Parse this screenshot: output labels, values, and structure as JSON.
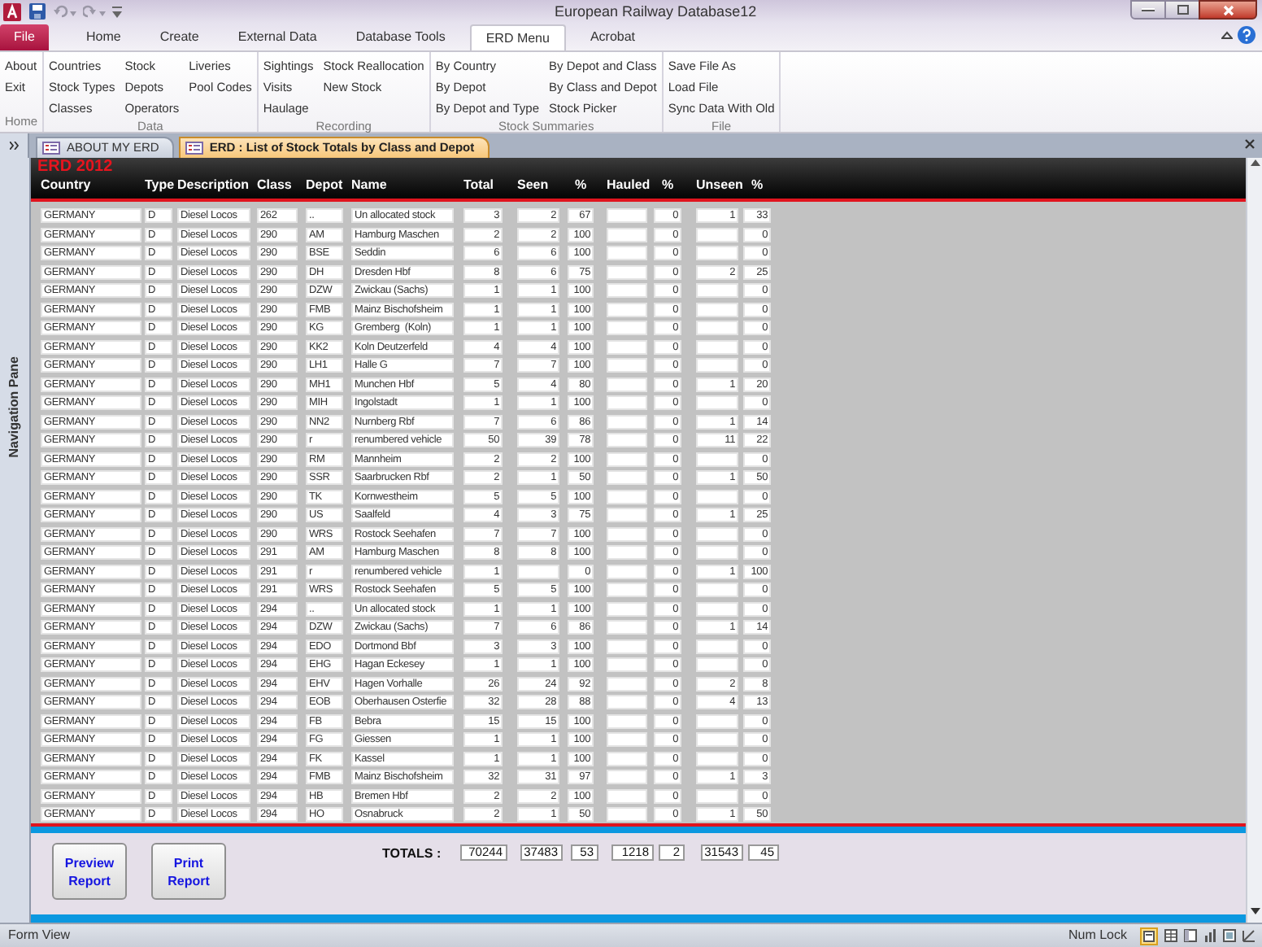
{
  "window": {
    "title": "European Railway Database12"
  },
  "ribbon": {
    "tabs": [
      {
        "label": "File",
        "kind": "file",
        "selected": false
      },
      {
        "label": "Home",
        "kind": "tab",
        "selected": false
      },
      {
        "label": "Create",
        "kind": "tab",
        "selected": false
      },
      {
        "label": "External Data",
        "kind": "tab",
        "selected": false
      },
      {
        "label": "Database Tools",
        "kind": "tab",
        "selected": false
      },
      {
        "label": "ERD Menu",
        "kind": "tab",
        "selected": true
      },
      {
        "label": "Acrobat",
        "kind": "tab",
        "selected": false
      }
    ],
    "groups": [
      {
        "label": "Home",
        "columns": [
          [
            "About",
            "Exit"
          ]
        ]
      },
      {
        "label": "Data",
        "columns": [
          [
            "Countries",
            "Stock Types",
            "Classes"
          ],
          [
            "Stock",
            "Depots",
            "Operators"
          ],
          [
            "Liveries",
            "Pool Codes"
          ]
        ]
      },
      {
        "label": "Recording",
        "columns": [
          [
            "Sightings",
            "Visits",
            "Haulage"
          ],
          [
            "Stock Reallocation",
            "New Stock"
          ]
        ]
      },
      {
        "label": "Stock Summaries",
        "columns": [
          [
            "By Country",
            "By Depot",
            "By Depot and Type"
          ],
          [
            "By Depot and Class",
            "By Class and Depot",
            "Stock Picker"
          ]
        ]
      },
      {
        "label": "File",
        "columns": [
          [
            "Save File As",
            "Load File",
            "Sync Data With Old"
          ]
        ]
      }
    ]
  },
  "document_tabs": [
    {
      "label": "ABOUT MY ERD",
      "selected": false
    },
    {
      "label": "ERD : List of Stock Totals by Class and Depot",
      "selected": true
    }
  ],
  "navigation_pane": {
    "label": "Navigation Pane"
  },
  "form": {
    "title": "ERD 2012",
    "columns": [
      "Country",
      "Type",
      "Description",
      "Class",
      "Depot",
      "Name",
      "Total",
      "Seen",
      "%",
      "Hauled",
      "%",
      "Unseen",
      "%"
    ],
    "rows": [
      {
        "country": "GERMANY",
        "type": "D",
        "description": "Diesel Locos",
        "class": "262",
        "depot": "..",
        "name": "Un allocated stock",
        "total": "3",
        "seen": "2",
        "seen_pct": "67",
        "hauled_pct": "0",
        "unseen": "1",
        "unseen_pct": "33"
      },
      {
        "country": "GERMANY",
        "type": "D",
        "description": "Diesel Locos",
        "class": "290",
        "depot": "AM",
        "name": "Hamburg Maschen",
        "total": "2",
        "seen": "2",
        "seen_pct": "100",
        "hauled_pct": "0",
        "unseen_pct": "0"
      },
      {
        "country": "GERMANY",
        "type": "D",
        "description": "Diesel Locos",
        "class": "290",
        "depot": "BSE",
        "name": "Seddin",
        "total": "6",
        "seen": "6",
        "seen_pct": "100",
        "hauled_pct": "0",
        "unseen_pct": "0"
      },
      {
        "country": "GERMANY",
        "type": "D",
        "description": "Diesel Locos",
        "class": "290",
        "depot": "DH",
        "name": "Dresden Hbf",
        "total": "8",
        "seen": "6",
        "seen_pct": "75",
        "hauled_pct": "0",
        "unseen": "2",
        "unseen_pct": "25"
      },
      {
        "country": "GERMANY",
        "type": "D",
        "description": "Diesel Locos",
        "class": "290",
        "depot": "DZW",
        "name": "Zwickau (Sachs)",
        "total": "1",
        "seen": "1",
        "seen_pct": "100",
        "hauled_pct": "0",
        "unseen_pct": "0"
      },
      {
        "country": "GERMANY",
        "type": "D",
        "description": "Diesel Locos",
        "class": "290",
        "depot": "FMB",
        "name": "Mainz Bischofsheim",
        "total": "1",
        "seen": "1",
        "seen_pct": "100",
        "hauled_pct": "0",
        "unseen_pct": "0"
      },
      {
        "country": "GERMANY",
        "type": "D",
        "description": "Diesel Locos",
        "class": "290",
        "depot": "KG",
        "name": "Gremberg  (Koln)",
        "total": "1",
        "seen": "1",
        "seen_pct": "100",
        "hauled_pct": "0",
        "unseen_pct": "0"
      },
      {
        "country": "GERMANY",
        "type": "D",
        "description": "Diesel Locos",
        "class": "290",
        "depot": "KK2",
        "name": "Koln Deutzerfeld",
        "total": "4",
        "seen": "4",
        "seen_pct": "100",
        "hauled_pct": "0",
        "unseen_pct": "0"
      },
      {
        "country": "GERMANY",
        "type": "D",
        "description": "Diesel Locos",
        "class": "290",
        "depot": "LH1",
        "name": "Halle G",
        "total": "7",
        "seen": "7",
        "seen_pct": "100",
        "hauled_pct": "0",
        "unseen_pct": "0"
      },
      {
        "country": "GERMANY",
        "type": "D",
        "description": "Diesel Locos",
        "class": "290",
        "depot": "MH1",
        "name": "Munchen Hbf",
        "total": "5",
        "seen": "4",
        "seen_pct": "80",
        "hauled_pct": "0",
        "unseen": "1",
        "unseen_pct": "20"
      },
      {
        "country": "GERMANY",
        "type": "D",
        "description": "Diesel Locos",
        "class": "290",
        "depot": "MIH",
        "name": "Ingolstadt",
        "total": "1",
        "seen": "1",
        "seen_pct": "100",
        "hauled_pct": "0",
        "unseen_pct": "0"
      },
      {
        "country": "GERMANY",
        "type": "D",
        "description": "Diesel Locos",
        "class": "290",
        "depot": "NN2",
        "name": "Nurnberg Rbf",
        "total": "7",
        "seen": "6",
        "seen_pct": "86",
        "hauled_pct": "0",
        "unseen": "1",
        "unseen_pct": "14"
      },
      {
        "country": "GERMANY",
        "type": "D",
        "description": "Diesel Locos",
        "class": "290",
        "depot": "r",
        "name": "renumbered vehicle",
        "total": "50",
        "seen": "39",
        "seen_pct": "78",
        "hauled_pct": "0",
        "unseen": "11",
        "unseen_pct": "22"
      },
      {
        "country": "GERMANY",
        "type": "D",
        "description": "Diesel Locos",
        "class": "290",
        "depot": "RM",
        "name": "Mannheim",
        "total": "2",
        "seen": "2",
        "seen_pct": "100",
        "hauled_pct": "0",
        "unseen_pct": "0"
      },
      {
        "country": "GERMANY",
        "type": "D",
        "description": "Diesel Locos",
        "class": "290",
        "depot": "SSR",
        "name": "Saarbrucken Rbf",
        "total": "2",
        "seen": "1",
        "seen_pct": "50",
        "hauled_pct": "0",
        "unseen": "1",
        "unseen_pct": "50"
      },
      {
        "country": "GERMANY",
        "type": "D",
        "description": "Diesel Locos",
        "class": "290",
        "depot": "TK",
        "name": "Kornwestheim",
        "total": "5",
        "seen": "5",
        "seen_pct": "100",
        "hauled_pct": "0",
        "unseen_pct": "0"
      },
      {
        "country": "GERMANY",
        "type": "D",
        "description": "Diesel Locos",
        "class": "290",
        "depot": "US",
        "name": "Saalfeld",
        "total": "4",
        "seen": "3",
        "seen_pct": "75",
        "hauled_pct": "0",
        "unseen": "1",
        "unseen_pct": "25"
      },
      {
        "country": "GERMANY",
        "type": "D",
        "description": "Diesel Locos",
        "class": "290",
        "depot": "WRS",
        "name": "Rostock Seehafen",
        "total": "7",
        "seen": "7",
        "seen_pct": "100",
        "hauled_pct": "0",
        "unseen_pct": "0"
      },
      {
        "country": "GERMANY",
        "type": "D",
        "description": "Diesel Locos",
        "class": "291",
        "depot": "AM",
        "name": "Hamburg Maschen",
        "total": "8",
        "seen": "8",
        "seen_pct": "100",
        "hauled_pct": "0",
        "unseen_pct": "0"
      },
      {
        "country": "GERMANY",
        "type": "D",
        "description": "Diesel Locos",
        "class": "291",
        "depot": "r",
        "name": "renumbered vehicle",
        "total": "1",
        "seen_pct": "0",
        "hauled_pct": "0",
        "unseen": "1",
        "unseen_pct": "100"
      },
      {
        "country": "GERMANY",
        "type": "D",
        "description": "Diesel Locos",
        "class": "291",
        "depot": "WRS",
        "name": "Rostock Seehafen",
        "total": "5",
        "seen": "5",
        "seen_pct": "100",
        "hauled_pct": "0",
        "unseen_pct": "0"
      },
      {
        "country": "GERMANY",
        "type": "D",
        "description": "Diesel Locos",
        "class": "294",
        "depot": "..",
        "name": "Un allocated stock",
        "total": "1",
        "seen": "1",
        "seen_pct": "100",
        "hauled_pct": "0",
        "unseen_pct": "0"
      },
      {
        "country": "GERMANY",
        "type": "D",
        "description": "Diesel Locos",
        "class": "294",
        "depot": "DZW",
        "name": "Zwickau (Sachs)",
        "total": "7",
        "seen": "6",
        "seen_pct": "86",
        "hauled_pct": "0",
        "unseen": "1",
        "unseen_pct": "14"
      },
      {
        "country": "GERMANY",
        "type": "D",
        "description": "Diesel Locos",
        "class": "294",
        "depot": "EDO",
        "name": "Dortmond Bbf",
        "total": "3",
        "seen": "3",
        "seen_pct": "100",
        "hauled_pct": "0",
        "unseen_pct": "0"
      },
      {
        "country": "GERMANY",
        "type": "D",
        "description": "Diesel Locos",
        "class": "294",
        "depot": "EHG",
        "name": "Hagan Eckesey",
        "total": "1",
        "seen": "1",
        "seen_pct": "100",
        "hauled_pct": "0",
        "unseen_pct": "0"
      },
      {
        "country": "GERMANY",
        "type": "D",
        "description": "Diesel Locos",
        "class": "294",
        "depot": "EHV",
        "name": "Hagen Vorhalle",
        "total": "26",
        "seen": "24",
        "seen_pct": "92",
        "hauled_pct": "0",
        "unseen": "2",
        "unseen_pct": "8"
      },
      {
        "country": "GERMANY",
        "type": "D",
        "description": "Diesel Locos",
        "class": "294",
        "depot": "EOB",
        "name": "Oberhausen Osterfie",
        "total": "32",
        "seen": "28",
        "seen_pct": "88",
        "hauled_pct": "0",
        "unseen": "4",
        "unseen_pct": "13"
      },
      {
        "country": "GERMANY",
        "type": "D",
        "description": "Diesel Locos",
        "class": "294",
        "depot": "FB",
        "name": "Bebra",
        "total": "15",
        "seen": "15",
        "seen_pct": "100",
        "hauled_pct": "0",
        "unseen_pct": "0"
      },
      {
        "country": "GERMANY",
        "type": "D",
        "description": "Diesel Locos",
        "class": "294",
        "depot": "FG",
        "name": "Giessen",
        "total": "1",
        "seen": "1",
        "seen_pct": "100",
        "hauled_pct": "0",
        "unseen_pct": "0"
      },
      {
        "country": "GERMANY",
        "type": "D",
        "description": "Diesel Locos",
        "class": "294",
        "depot": "FK",
        "name": "Kassel",
        "total": "1",
        "seen": "1",
        "seen_pct": "100",
        "hauled_pct": "0",
        "unseen_pct": "0"
      },
      {
        "country": "GERMANY",
        "type": "D",
        "description": "Diesel Locos",
        "class": "294",
        "depot": "FMB",
        "name": "Mainz Bischofsheim",
        "total": "32",
        "seen": "31",
        "seen_pct": "97",
        "hauled_pct": "0",
        "unseen": "1",
        "unseen_pct": "3"
      },
      {
        "country": "GERMANY",
        "type": "D",
        "description": "Diesel Locos",
        "class": "294",
        "depot": "HB",
        "name": "Bremen Hbf",
        "total": "2",
        "seen": "2",
        "seen_pct": "100",
        "hauled_pct": "0",
        "unseen_pct": "0"
      },
      {
        "country": "GERMANY",
        "type": "D",
        "description": "Diesel Locos",
        "class": "294",
        "depot": "HO",
        "name": "Osnabruck",
        "total": "2",
        "seen": "1",
        "seen_pct": "50",
        "hauled_pct": "0",
        "unseen": "1",
        "unseen_pct": "50"
      }
    ],
    "totals": {
      "label": "TOTALS :",
      "values": [
        "70244",
        "37483",
        "53",
        "1218",
        "2",
        "31543",
        "45"
      ]
    },
    "buttons": [
      "Preview Report",
      "Print Report"
    ]
  },
  "status_bar": {
    "left": "Form View",
    "right": "Num Lock"
  }
}
